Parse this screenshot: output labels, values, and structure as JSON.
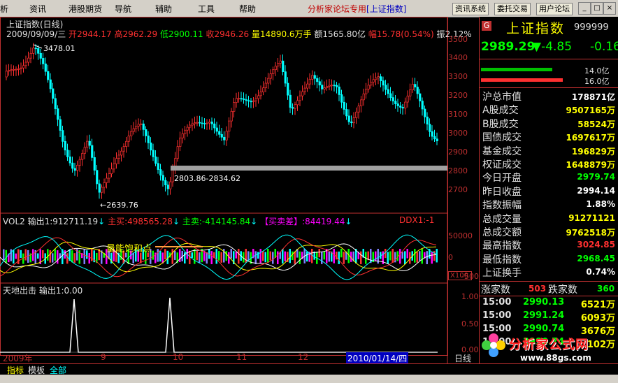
{
  "menu": {
    "items": [
      "析",
      "资讯",
      "港股期货",
      "导航",
      "辅助",
      "工具",
      "帮助"
    ],
    "title_main": "分析家论坛专用",
    "title_sub": "[上证指数]",
    "buttons": [
      "资讯系统",
      "委托交易",
      "用户论坛"
    ]
  },
  "window_controls": [
    "_",
    "□",
    "×"
  ],
  "chart": {
    "title": "上证指数(日线)",
    "date": "2009/09/09/三",
    "open_label": "开",
    "open": "2944.17",
    "high_label": "高",
    "high": "2962.29",
    "low_label": "低",
    "low": "2900.11",
    "close_label": "收",
    "close": "2946.26",
    "vol_label": "量",
    "vol": "14890.6万手",
    "amt_label": "额",
    "amt": "1565.80亿",
    "chg_label": "幅",
    "chg": "15.78(0.54%)",
    "amp_label": "振",
    "amp": "2.12%",
    "high_mark": "3478.01",
    "low_mark": "←2639.76",
    "range_mark": "2803.86-2834.62",
    "y_ticks": [
      "3500",
      "3400",
      "3300",
      "3200",
      "3100",
      "3000",
      "2900",
      "2800",
      "2700"
    ]
  },
  "vol_panel": {
    "name": "VOL2",
    "out1": "输出1:912711.19",
    "buy": "主买:498565.28",
    "sell": "主卖:-414145.84",
    "diff": "【买卖差】:84419.44",
    "ddx": "DDX1:-1",
    "annotation": "量能饱和点",
    "y_ticks": [
      "50000",
      "0",
      "-50000"
    ],
    "scale": "X100"
  },
  "ind_panel": {
    "name": "天地出击",
    "out1": "输出1:0.00",
    "y_ticks": [
      "1.00",
      "0.50",
      "0.00"
    ]
  },
  "x_axis": {
    "year": "2009年",
    "labels": [
      "9",
      "10",
      "11",
      "12"
    ],
    "cursor": "2010/01/14/四",
    "period": "日线"
  },
  "bottom_tabs": [
    "指标",
    "模板",
    "全部"
  ],
  "quote": {
    "name": "上证指数",
    "code": "999999",
    "price": "2989.29",
    "change": "▼-4.85",
    "pct": "-0.16",
    "bar1": "14.0亿",
    "bar2": "16.0亿",
    "bar1_fraction": 0.875,
    "bar2_fraction": 1.0,
    "rows": [
      {
        "k": "沪总市值",
        "v": "178871亿",
        "c": "#ffffff"
      },
      {
        "k": "A股成交",
        "v": "9507165万",
        "c": "#ffff00"
      },
      {
        "k": "B股成交",
        "v": "58524万",
        "c": "#ffff00"
      },
      {
        "k": "国债成交",
        "v": "1697617万",
        "c": "#ffff00"
      },
      {
        "k": "基金成交",
        "v": "196829万",
        "c": "#ffff00"
      },
      {
        "k": "权证成交",
        "v": "1648879万",
        "c": "#ffff00"
      },
      {
        "k": "今日开盘",
        "v": "2979.74",
        "c": "#00ff00"
      },
      {
        "k": "昨日收盘",
        "v": "2994.14",
        "c": "#ffffff"
      },
      {
        "k": "指数振幅",
        "v": "1.88%",
        "c": "#ffffff"
      },
      {
        "k": "总成交量",
        "v": "91271121",
        "c": "#ffff00"
      },
      {
        "k": "总成交额",
        "v": "9762518万",
        "c": "#ffff00"
      },
      {
        "k": "最高指数",
        "v": "3024.85",
        "c": "#ff3030"
      },
      {
        "k": "最低指数",
        "v": "2968.45",
        "c": "#00ff00"
      },
      {
        "k": "上证换手",
        "v": "0.74%",
        "c": "#ffffff"
      }
    ],
    "up_label": "涨家数",
    "up": "503",
    "down_label": "跌家数",
    "down": "360",
    "ticks": [
      {
        "t": "15:00",
        "p": "2990.13",
        "v": "6521万"
      },
      {
        "t": "15:00",
        "p": "2991.24",
        "v": "6093万"
      },
      {
        "t": "15:00",
        "p": "2990.74",
        "v": "3676万"
      },
      {
        "t": "15:00",
        "p": "2990.74",
        "v": "102万"
      }
    ]
  },
  "watermark": {
    "text": "分析家公式网",
    "url": "www.88gs.com"
  },
  "colors": {
    "up": "#ff3030",
    "down": "#00ffff",
    "frame": "#c03030",
    "yellow": "#ffff00",
    "green": "#00ff00"
  }
}
